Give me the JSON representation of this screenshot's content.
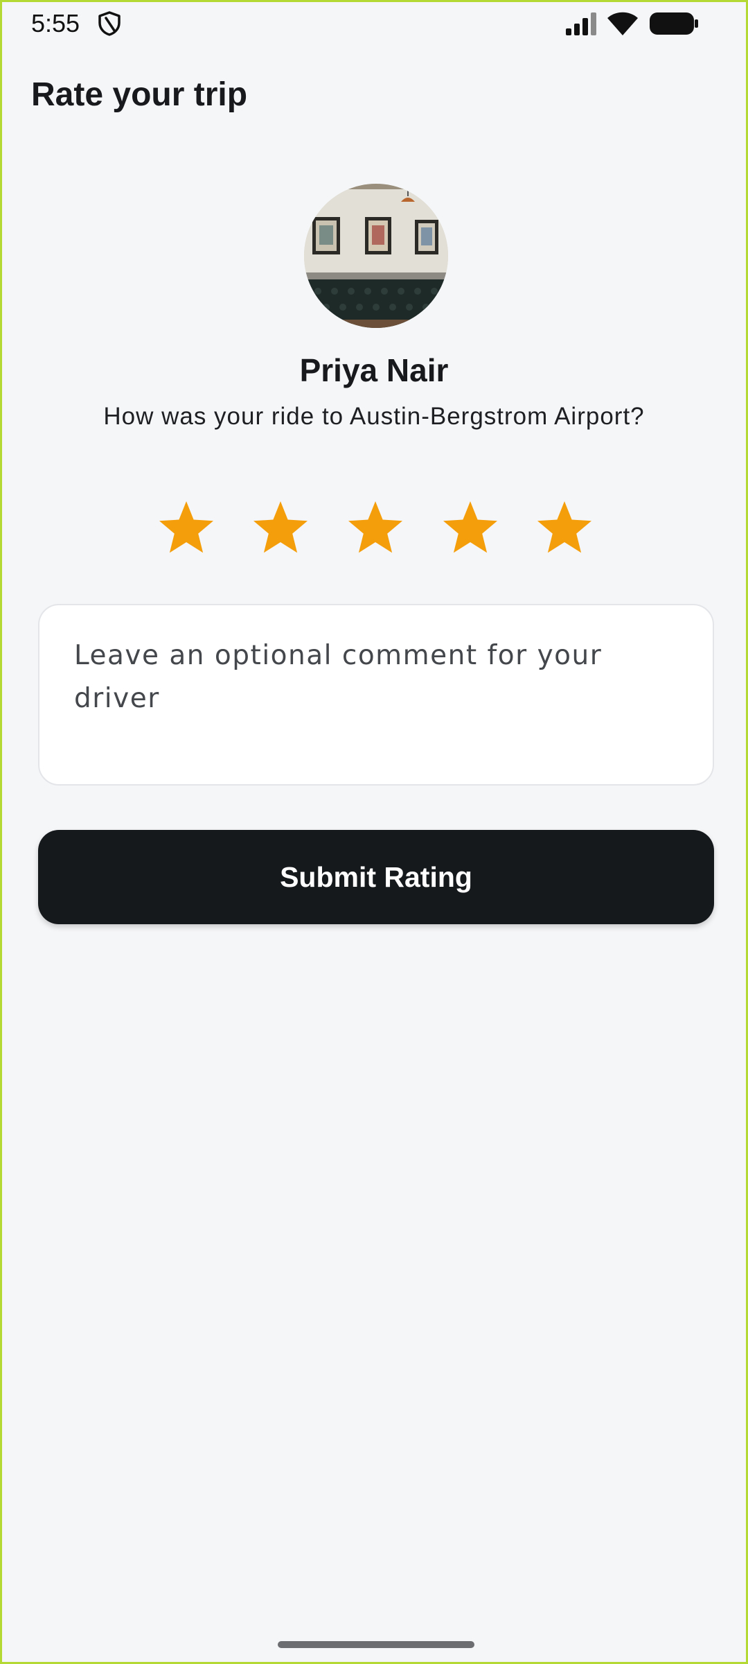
{
  "status_bar": {
    "time": "5:55",
    "icons": [
      "shield-icon",
      "cellular-signal-icon",
      "wifi-icon",
      "battery-icon"
    ]
  },
  "header": {
    "title": "Rate your trip"
  },
  "driver": {
    "name": "Priya Nair",
    "photo": "avatar-photo"
  },
  "prompt": {
    "question": "How was your ride to Austin-Bergstrom Airport?"
  },
  "rating": {
    "max_stars": 5,
    "selected": 5,
    "star_icon": "star-icon",
    "color": "#f59e0b"
  },
  "comment": {
    "placeholder": "Leave an optional comment for your driver",
    "value": ""
  },
  "submit": {
    "label": "Submit Rating"
  },
  "colors": {
    "background": "#f5f6f8",
    "button": "#16191c",
    "star": "#f59e0b"
  }
}
